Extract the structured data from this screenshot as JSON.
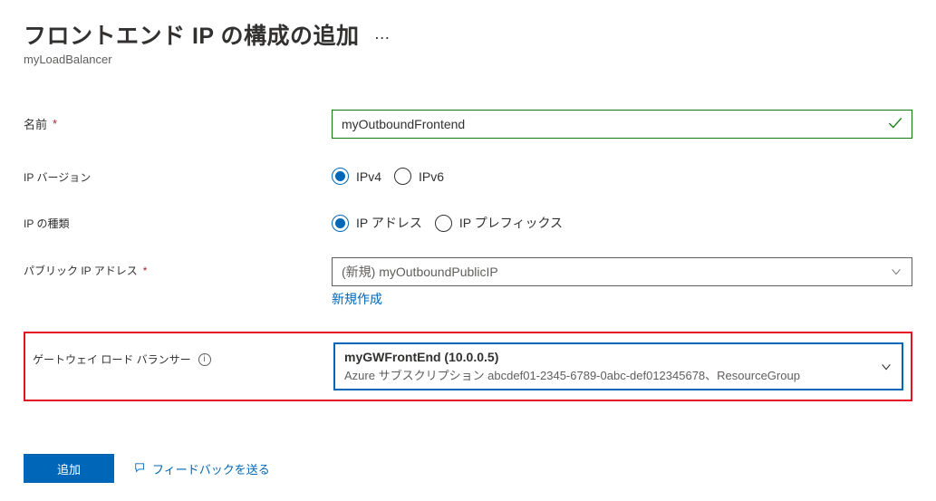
{
  "header": {
    "title": "フロントエンド IP の構成の追加",
    "breadcrumb": "myLoadBalancer"
  },
  "labels": {
    "name": "名前",
    "ipVersion": "IP バージョン",
    "ipType": "IP の種類",
    "publicIp": "パブリック IP アドレス",
    "gwlb": "ゲートウェイ ロード バランサー"
  },
  "fields": {
    "nameValue": "myOutboundFrontend",
    "ipVersion": {
      "ipv4": "IPv4",
      "ipv6": "IPv6",
      "selected": "ipv4"
    },
    "ipType": {
      "address": "IP アドレス",
      "prefix": "IP プレフィックス",
      "selected": "address"
    },
    "publicIp": {
      "selectedText": "(新規) myOutboundPublicIP",
      "createNewLabel": "新規作成"
    },
    "gwlb": {
      "title": "myGWFrontEnd (10.0.0.5)",
      "subtitle": "Azure サブスクリプション abcdef01-2345-6789-0abc-def012345678、ResourceGroup"
    }
  },
  "footer": {
    "addButton": "追加",
    "feedback": "フィードバックを送る"
  }
}
